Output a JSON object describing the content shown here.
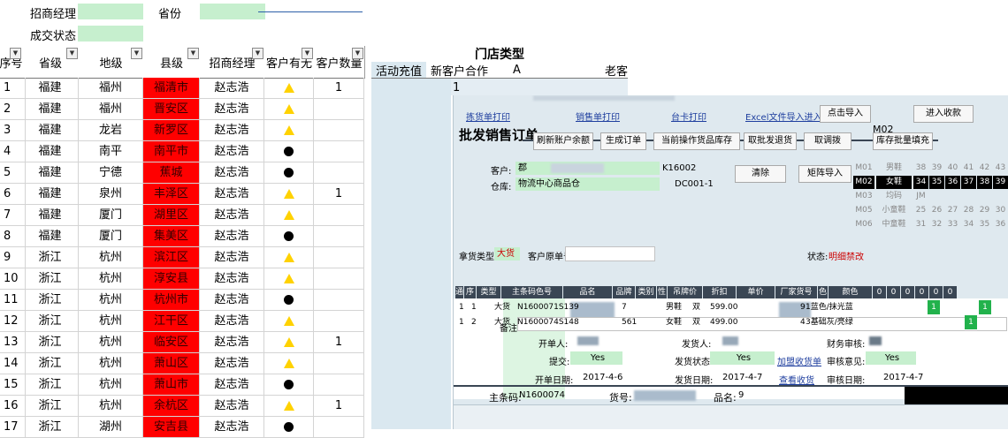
{
  "filters": {
    "manager_label": "招商经理",
    "province_label": "省份",
    "deal_status_label": "成交状态"
  },
  "headers": {
    "seq": "序号",
    "province": "省级",
    "city": "地级",
    "county": "县级",
    "manager": "招商经理",
    "has_customer": "客户有无",
    "customer_count": "客户数量",
    "store_type": "门店类型",
    "activity_recharge": "活动充值",
    "new_customer": "新客户合作",
    "col_a": "A",
    "old_customer": "老客"
  },
  "rows": [
    {
      "no": "1",
      "province": "福建",
      "city": "福州",
      "county": "福清市",
      "manager": "赵志浩",
      "mark": "triangle",
      "count": "1"
    },
    {
      "no": "2",
      "province": "福建",
      "city": "福州",
      "county": "晋安区",
      "manager": "赵志浩",
      "mark": "triangle",
      "count": ""
    },
    {
      "no": "3",
      "province": "福建",
      "city": "龙岩",
      "county": "新罗区",
      "manager": "赵志浩",
      "mark": "triangle",
      "count": ""
    },
    {
      "no": "4",
      "province": "福建",
      "city": "南平",
      "county": "南平市",
      "manager": "赵志浩",
      "mark": "dot",
      "count": ""
    },
    {
      "no": "5",
      "province": "福建",
      "city": "宁德",
      "county": "蕉城",
      "manager": "赵志浩",
      "mark": "dot",
      "count": ""
    },
    {
      "no": "6",
      "province": "福建",
      "city": "泉州",
      "county": "丰泽区",
      "manager": "赵志浩",
      "mark": "triangle",
      "count": "1"
    },
    {
      "no": "7",
      "province": "福建",
      "city": "厦门",
      "county": "湖里区",
      "manager": "赵志浩",
      "mark": "triangle",
      "count": ""
    },
    {
      "no": "8",
      "province": "福建",
      "city": "厦门",
      "county": "集美区",
      "manager": "赵志浩",
      "mark": "dot",
      "count": ""
    },
    {
      "no": "9",
      "province": "浙江",
      "city": "杭州",
      "county": "滨江区",
      "manager": "赵志浩",
      "mark": "triangle",
      "count": ""
    },
    {
      "no": "10",
      "province": "浙江",
      "city": "杭州",
      "county": "淳安县",
      "manager": "赵志浩",
      "mark": "triangle",
      "count": ""
    },
    {
      "no": "11",
      "province": "浙江",
      "city": "杭州",
      "county": "杭州市",
      "manager": "赵志浩",
      "mark": "dot",
      "count": ""
    },
    {
      "no": "12",
      "province": "浙江",
      "city": "杭州",
      "county": "江干区",
      "manager": "赵志浩",
      "mark": "triangle",
      "count": ""
    },
    {
      "no": "13",
      "province": "浙江",
      "city": "杭州",
      "county": "临安区",
      "manager": "赵志浩",
      "mark": "triangle",
      "count": "1"
    },
    {
      "no": "14",
      "province": "浙江",
      "city": "杭州",
      "county": "萧山区",
      "manager": "赵志浩",
      "mark": "triangle",
      "count": ""
    },
    {
      "no": "15",
      "province": "浙江",
      "city": "杭州",
      "county": "萧山市",
      "manager": "赵志浩",
      "mark": "dot",
      "count": ""
    },
    {
      "no": "16",
      "province": "浙江",
      "city": "杭州",
      "county": "余杭区",
      "manager": "赵志浩",
      "mark": "triangle",
      "count": "1"
    },
    {
      "no": "17",
      "province": "浙江",
      "city": "湖州",
      "county": "安吉县",
      "manager": "赵志浩",
      "mark": "dot",
      "count": ""
    }
  ],
  "store_row1_value": "1",
  "order": {
    "links": [
      "拣货单打印",
      "销售单打印",
      "台卡打印",
      "Excel文件导入进入"
    ],
    "import_btn": "点击导入",
    "receive_btn": "进入收款",
    "title": "批发销售订单",
    "toolbar": [
      "刷新账户余额",
      "生成订单",
      "当前操作货品库存",
      "取批发退货",
      "取调拨",
      "库存批量填充"
    ],
    "customer_label": "客户:",
    "customer_value": "郡",
    "customer_code": "K16002",
    "warehouse_label": "仓库:",
    "warehouse_value": "物流中心商品仓",
    "warehouse_code": "DC001-1",
    "clear_btn": "清除",
    "matrix_import_btn": "矩阵导入",
    "size_code": "M02",
    "size_rows": [
      {
        "code": "M01",
        "name": "男鞋",
        "sizes": [
          "38",
          "39",
          "40",
          "41",
          "42",
          "43"
        ]
      },
      {
        "code": "M02",
        "name": "女鞋",
        "sizes": [
          "34",
          "35",
          "36",
          "37",
          "38",
          "39"
        ]
      },
      {
        "code": "M03",
        "name": "均码",
        "sizes": [
          "JM",
          "",
          "",
          "",
          "",
          ""
        ]
      },
      {
        "code": "M05",
        "name": "小童鞋",
        "sizes": [
          "25",
          "26",
          "27",
          "28",
          "29",
          "30"
        ]
      },
      {
        "code": "M06",
        "name": "中童鞋",
        "sizes": [
          "31",
          "32",
          "33",
          "34",
          "35",
          "36"
        ]
      }
    ],
    "goods_type_label": "拿货类型:",
    "goods_type_value": "大货",
    "customer_order_label": "客户原单号:",
    "status_label": "状态:",
    "status_value": "明细禁改",
    "grid_headers": [
      "通",
      "序",
      "类型",
      "主条码色号",
      "品名",
      "品牌",
      "类别",
      "性",
      "吊牌价",
      "折扣",
      "单价",
      "厂家货号",
      "色",
      "颜色",
      "0",
      "0",
      "0",
      "0",
      "0",
      "0"
    ],
    "grid_rows": [
      {
        "seq": "1",
        "no": "1",
        "type": "大货",
        "code": "N1600071S139",
        "name": "7",
        "cat": "男鞋",
        "sex": "双",
        "price": "599.00",
        "fno": "9",
        "color": "1蓝色/抹光蓝"
      },
      {
        "seq": "1",
        "no": "2",
        "type": "大货",
        "code": "N1600074S148",
        "name": "561",
        "cat": "女鞋",
        "sex": "双",
        "price": "499.00",
        "fno": "4",
        "color": "3基础灰/亮绿"
      }
    ],
    "grid_marks": [
      "1",
      "1",
      "1"
    ],
    "remark_label": "备注:",
    "creator_label": "开单人:",
    "shipper_label": "发货人:",
    "finance_label": "财务审核:",
    "submit_label": "提交:",
    "submit_value": "Yes",
    "ship_status_label": "发货状态:",
    "ship_status_value": "Yes",
    "add_receipt_link": "加盟收货单",
    "audit_label": "审核意见:",
    "audit_value": "Yes",
    "open_date_label": "开单日期:",
    "open_date_value": "2017-4-6",
    "ship_date_label": "发货日期:",
    "ship_date_value": "2017-4-7",
    "view_receipt_link": "查看收货",
    "audit_date_label": "审核日期:",
    "audit_date_value": "2017-4-7",
    "barcode_label": "主条码:",
    "barcode_value": "N1600074",
    "item_no_label": "货号:",
    "item_name_label": "品名:",
    "item_name_value": "9"
  }
}
